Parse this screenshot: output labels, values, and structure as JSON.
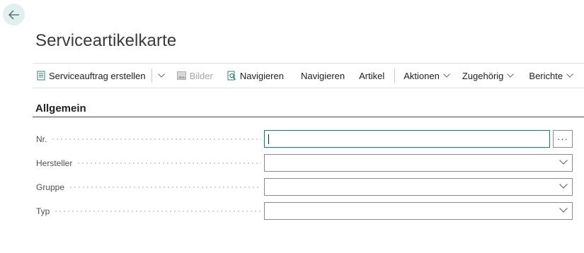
{
  "page": {
    "title": "Serviceartikelkarte"
  },
  "actionbar": {
    "create_service_order": "Serviceauftrag erstellen",
    "pictures": "Bilder",
    "navigate_find": "Navigieren",
    "navigate": "Navigieren",
    "item": "Artikel",
    "actions": "Aktionen",
    "related": "Zugehörig",
    "reports": "Berichte"
  },
  "section": {
    "title": "Allgemein",
    "fields": [
      {
        "label": "Nr.",
        "value": ""
      },
      {
        "label": "Hersteller",
        "value": ""
      },
      {
        "label": "Gruppe",
        "value": ""
      },
      {
        "label": "Typ",
        "value": ""
      }
    ],
    "lookup_label": "···"
  },
  "colors": {
    "accent": "#008489",
    "back_bg": "#dff0f0"
  }
}
